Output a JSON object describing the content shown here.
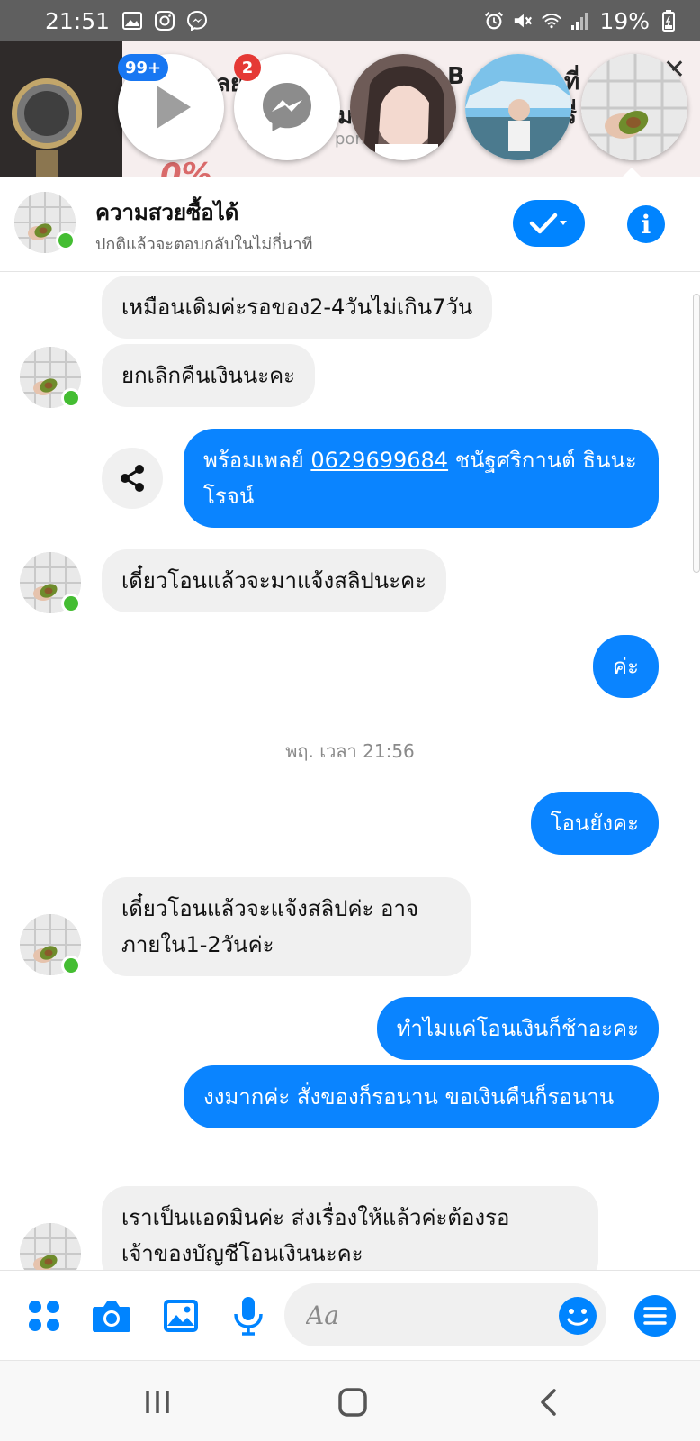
{
  "status_bar": {
    "time": "21:51",
    "battery": "19%",
    "icons": [
      "gallery-icon",
      "instagram-icon",
      "messenger-icon",
      "alarm-icon",
      "mute-icon",
      "wifi-icon",
      "signal-icon",
      "battery-icon"
    ]
  },
  "chat_heads": {
    "video_badge": "99+",
    "messenger_badge": "2",
    "items": [
      "video-play-head",
      "messenger-head",
      "contact-head-1",
      "contact-head-2",
      "contact-head-3"
    ]
  },
  "background_ad": {
    "partial_text_1": "ลย",
    "partial_text_2": "B",
    "partial_text_3": "ที่",
    "partial_text_4": "ม",
    "partial_text_5": "รี่",
    "sponsored_fragment": "pons",
    "promo_fragment": "0%"
  },
  "header": {
    "title": "ความสวยซื้อได้",
    "subtitle": "ปกติแล้วจะตอบกลับในไม่กี่นาที"
  },
  "messages": [
    {
      "id": "m1",
      "side": "in",
      "text": "เหมือนเดิมค่ะรอของ2-4วันไม่เกิน7วัน"
    },
    {
      "id": "m2",
      "side": "in",
      "text": "ยกเลิกคืนเงินนะคะ"
    },
    {
      "id": "m3",
      "side": "out",
      "prefix": "พร้อมเพลย์ ",
      "link": "0629699684",
      "suffix": " ชนัฐศริกานต์ ธินนะโรจน์"
    },
    {
      "id": "m4",
      "side": "in",
      "text": "เดี๋ยวโอนแล้วจะมาแจ้งสลิปนะคะ"
    },
    {
      "id": "m5",
      "side": "out",
      "text": "ค่ะ"
    },
    {
      "id": "m6",
      "side": "out",
      "text": "โอนยังคะ"
    },
    {
      "id": "m7",
      "side": "in",
      "text": "เดี๋ยวโอนแล้วจะแจ้งสลิปค่ะ อาจภายใน1-2วันค่ะ"
    },
    {
      "id": "m8",
      "side": "out",
      "text": "ทำไมแค่โอนเงินก็ช้าอะคะ"
    },
    {
      "id": "m9",
      "side": "out",
      "text": "งงมากค่ะ สั่งของก็รอนาน ขอเงินคืนก็รอนาน"
    },
    {
      "id": "m10",
      "side": "in",
      "text": "เราเป็นแอดมินค่ะ ส่งเรื่องให้แล้วค่ะต้องรอเจ้าของบัญชีโอนเงินนะคะ"
    }
  ],
  "timestamp": "พฤ. เวลา 21:56",
  "composer": {
    "placeholder": "Aa",
    "icons": [
      "apps-icon",
      "camera-icon",
      "gallery-icon",
      "microphone-icon",
      "emoji-icon",
      "menu-icon"
    ]
  },
  "nav_bar": {
    "icons": [
      "recent-apps-icon",
      "home-icon",
      "back-icon"
    ]
  },
  "colors": {
    "accent": "#0084ff",
    "outgoing_bubble": "#0a84ff",
    "incoming_bubble": "#f0f0f0",
    "online": "#44bd32",
    "badge_red": "#e53935",
    "status_bar": "#5f5f5f"
  }
}
